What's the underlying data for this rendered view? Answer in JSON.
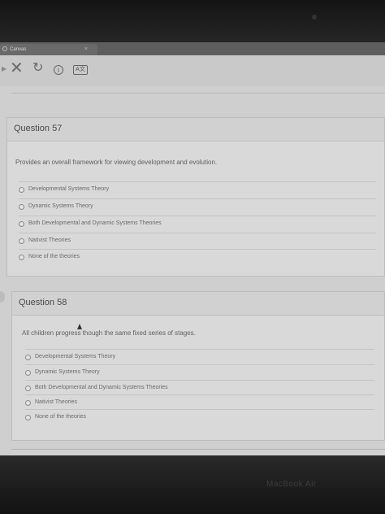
{
  "browser": {
    "tab_title": "Canvas",
    "tab_close": "×",
    "close_glyph": "✕",
    "reload_glyph": "↻",
    "info_glyph": "i",
    "translate_glyph": "A文"
  },
  "questions": [
    {
      "title": "Question 57",
      "text": "Provides an overall framework for viewing development and evolution.",
      "options": [
        "Developmental Systems Theory",
        "Dynamic Systems Theory",
        "Both Developmental and Dynamic Systems Theories",
        "Nativist Theories",
        "None of the theories"
      ]
    },
    {
      "title": "Question 58",
      "text": "All children progress though the same fixed series of stages.",
      "options": [
        "Developmental Systems Theory",
        "Dynamic Systems Theory",
        "Both Developmental and Dynamic Systems Theories",
        "Nativist Theories",
        "None of the theories"
      ]
    }
  ],
  "device": {
    "label": "MacBook Air"
  }
}
